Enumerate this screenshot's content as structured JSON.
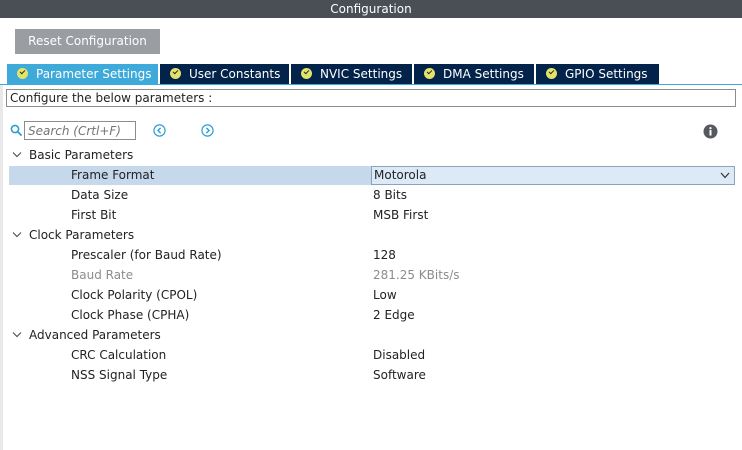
{
  "window": {
    "title": "Configuration"
  },
  "toolbar": {
    "reset_label": "Reset Configuration"
  },
  "tabs": [
    {
      "label": "Parameter Settings",
      "active": true
    },
    {
      "label": "User Constants",
      "active": false
    },
    {
      "label": "NVIC Settings",
      "active": false
    },
    {
      "label": "DMA Settings",
      "active": false
    },
    {
      "label": "GPIO Settings",
      "active": false
    }
  ],
  "description": "Configure the below parameters :",
  "search": {
    "placeholder": "Search (Crtl+F)"
  },
  "icons": {
    "search": "search-icon",
    "prev": "chevron-left-circle-icon",
    "next": "chevron-right-circle-icon",
    "info": "info-icon",
    "expand": "chevron-down-icon"
  },
  "groups": [
    {
      "label": "Basic Parameters",
      "params": [
        {
          "name": "Frame Format",
          "value": "Motorola",
          "selected": true,
          "editable": true
        },
        {
          "name": "Data Size",
          "value": "8 Bits"
        },
        {
          "name": "First Bit",
          "value": "MSB First"
        }
      ]
    },
    {
      "label": "Clock Parameters",
      "params": [
        {
          "name": "Prescaler (for Baud Rate)",
          "value": "128"
        },
        {
          "name": "Baud Rate",
          "value": "281.25 KBits/s",
          "disabled": true
        },
        {
          "name": "Clock Polarity (CPOL)",
          "value": "Low"
        },
        {
          "name": "Clock Phase (CPHA)",
          "value": "2 Edge"
        }
      ]
    },
    {
      "label": "Advanced Parameters",
      "params": [
        {
          "name": "CRC Calculation",
          "value": "Disabled"
        },
        {
          "name": "NSS Signal Type",
          "value": "Software"
        }
      ]
    }
  ],
  "colors": {
    "titlebar": "#4a4f55",
    "tab_active": "#3eaad9",
    "tab_inactive": "#03234b",
    "selected_row": "#c5d8ec",
    "nav_icon": "#2a9fd6",
    "check_badge": "#e3e36a"
  }
}
